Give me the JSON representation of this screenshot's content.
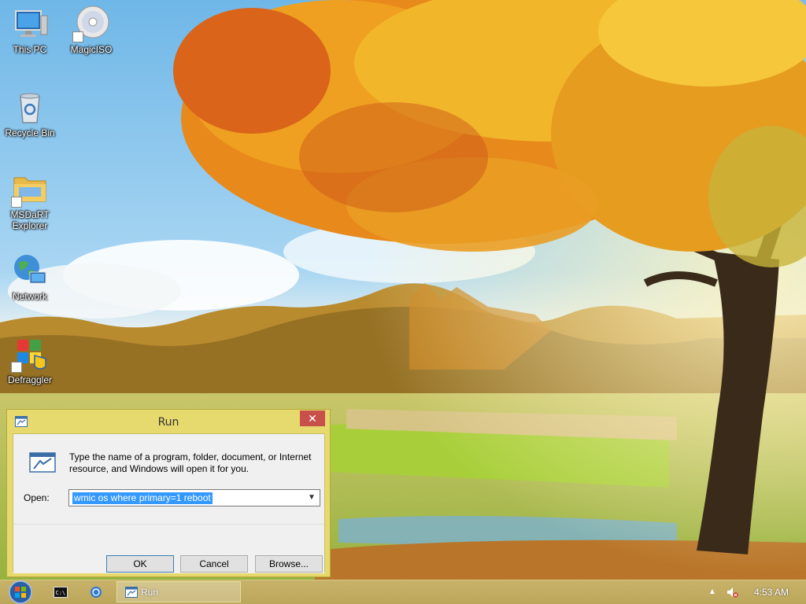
{
  "desktop": {
    "icons": [
      {
        "label": "This PC",
        "icon": "this-pc-icon"
      },
      {
        "label": "MagicISO",
        "icon": "magiciso-disc-icon"
      },
      {
        "label": "Recycle Bin",
        "icon": "recycle-bin-icon"
      },
      {
        "label": "MSDaRT Explorer",
        "icon": "folder-explorer-icon"
      },
      {
        "label": "Network",
        "icon": "network-globe-icon"
      },
      {
        "label": "Defraggler",
        "icon": "defraggler-icon"
      }
    ]
  },
  "run_dialog": {
    "title": "Run",
    "description": "Type the name of a program, folder, document, or Internet resource, and Windows will open it for you.",
    "open_label": "Open:",
    "open_value": "wmic os where primary=1 reboot",
    "ok_label": "OK",
    "cancel_label": "Cancel",
    "browse_label": "Browse..."
  },
  "taskbar": {
    "running_app": "Run",
    "clock": "4:53 AM"
  },
  "colors": {
    "dialog_frame": "#e6d96e",
    "close_button": "#c7504b",
    "selection": "#3399ff",
    "taskbar": "#c2ad62"
  }
}
